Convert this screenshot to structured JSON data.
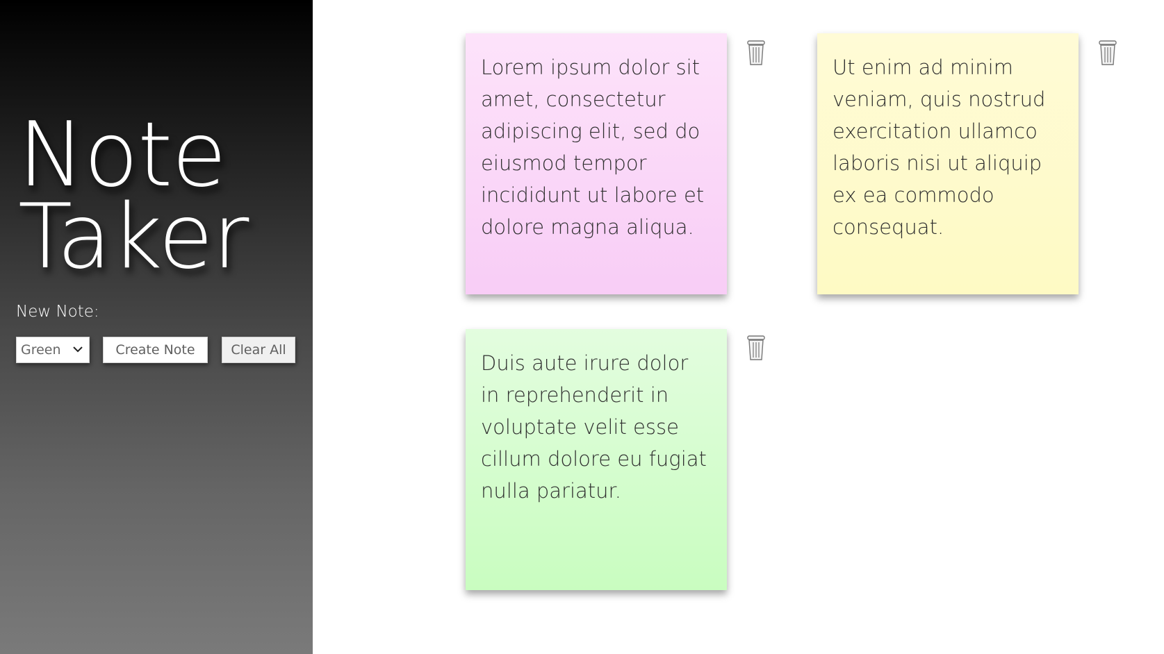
{
  "sidebar": {
    "title_line1": "Note",
    "title_line2": "Taker",
    "new_note_label": "New Note:",
    "color_select": {
      "selected": "Green",
      "icon": "chevron-down-icon"
    },
    "create_button_label": "Create Note",
    "clear_button_label": "Clear All"
  },
  "notes": [
    {
      "color": "pink",
      "text": "Lorem ipsum dolor sit amet, consectetur adipiscing elit, sed do eiusmod tempor incididunt ut labore et dolore magna aliqua.",
      "delete_icon": "trash-icon"
    },
    {
      "color": "yellow",
      "text": "Ut enim ad minim veniam, quis nostrud exercitation ullamco laboris nisi ut aliquip ex ea commodo consequat.",
      "delete_icon": "trash-icon"
    },
    {
      "color": "green",
      "text": "Duis aute irure dolor in reprehenderit in voluptate velit esse cillum dolore eu fugiat nulla pariatur.",
      "delete_icon": "trash-icon"
    }
  ],
  "colors": {
    "pink": "#f8cdf6",
    "yellow": "#fefac4",
    "green": "#c9fdc0"
  }
}
